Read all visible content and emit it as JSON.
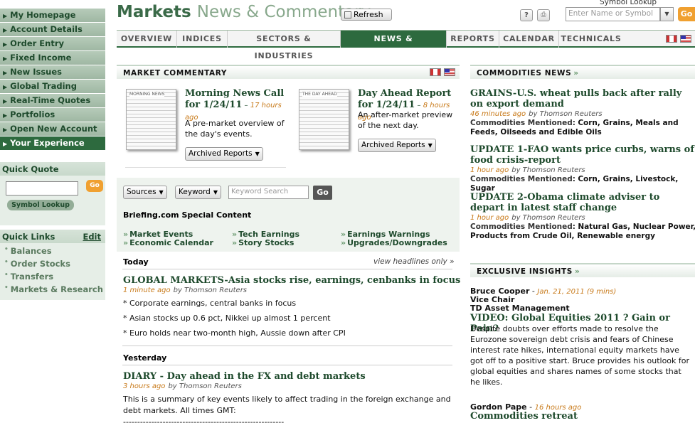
{
  "sidebar": {
    "nav": [
      {
        "label": "My Homepage"
      },
      {
        "label": "Account Details"
      },
      {
        "label": "Order Entry"
      },
      {
        "label": "Fixed Income"
      },
      {
        "label": "New Issues"
      },
      {
        "label": "Global Trading"
      },
      {
        "label": "Real-Time Quotes"
      },
      {
        "label": "Portfolios"
      },
      {
        "label": "Open New Account"
      },
      {
        "label": "Your Experience"
      }
    ],
    "quick_quote": {
      "title": "Quick Quote",
      "go": "Go",
      "symbol_lookup": "Symbol Lookup",
      "value": ""
    },
    "quick_links": {
      "title": "Quick Links",
      "edit": "Edit",
      "items": [
        "Balances",
        "Order Stocks",
        "Transfers",
        "Markets & Research"
      ]
    }
  },
  "header": {
    "title_main": "Markets",
    "title_sub": "News & Commentary",
    "refresh": "Refresh",
    "help": "?",
    "print": "⎙",
    "symbol_lookup_label": "Symbol Lookup",
    "search_placeholder": "Enter Name or Symbol",
    "go": "Go"
  },
  "tabs": [
    "OVERVIEW",
    "INDICES",
    "SECTORS & INDUSTRIES",
    "NEWS & COMMENTARY",
    "REPORTS",
    "CALENDAR",
    "TECHNICALS"
  ],
  "market_commentary": {
    "title": "MARKET COMMENTARY",
    "reports": [
      {
        "thumb": "MORNING NEWS",
        "title": "Morning News Call for 1/24/11",
        "sep": " – ",
        "time": "17 hours ago",
        "desc": "A pre-market overview of the day's events.",
        "archived": "Archived Reports"
      },
      {
        "thumb": "THE DAY AHEAD",
        "title": "Day Ahead Report for 1/24/11",
        "sep": " – ",
        "time": "8 hours ago",
        "desc": "An after-market preview of the next day.",
        "archived": "Archived Reports"
      }
    ]
  },
  "filters": {
    "sources": "Sources",
    "keyword": "Keyword",
    "keyword_placeholder": "Keyword Search",
    "go": "Go",
    "briefing_title": "Briefing.com Special Content",
    "links": [
      "Market Events",
      "Tech Earnings",
      "Earnings Warnings",
      "Economic Calendar",
      "Story Stocks",
      "Upgrades/Downgrades"
    ]
  },
  "news": {
    "today_label": "Today",
    "view_headlines": "view headlines only »",
    "today": {
      "headline": "GLOBAL MARKETS-Asia stocks rise, earnings, cenbanks in focus",
      "time": "1 minute ago",
      "source": "by Thomson Reuters",
      "bullets": [
        "* Corporate earnings, central banks in focus",
        "* Asian stocks up 0.6 pct, Nikkei up almost 1 percent",
        "* Euro holds near two-month high, Aussie down after CPI"
      ]
    },
    "yesterday_label": "Yesterday",
    "yesterday": {
      "headline": "DIARY - Day ahead in the FX and debt markets",
      "time": "3 hours ago",
      "source": "by Thomson Reuters",
      "body": "This is a summary of key events likely to affect trading in the foreign exchange and debt markets. All times GMT:",
      "rule": "---------------------------------------------------------"
    }
  },
  "commodities": {
    "title": "COMMODITIES NEWS",
    "mentioned_label": "Commodities Mentioned:",
    "items": [
      {
        "headline": "GRAINS-U.S. wheat pulls back after rally on export demand",
        "time": "46 minutes ago",
        "source": "by Thomson Reuters",
        "mentioned": "Corn, Grains, Meals and Feeds, Oilseeds and Edible Oils"
      },
      {
        "headline": "UPDATE 1-FAO wants price curbs, warns of food crisis-report",
        "time": "1 hour ago",
        "source": "by Thomson Reuters",
        "mentioned": "Corn, Grains, Livestock, Sugar"
      },
      {
        "headline": "UPDATE 2-Obama climate adviser to depart in latest staff change",
        "time": "1 hour ago",
        "source": "by Thomson Reuters",
        "mentioned": "Natural Gas, Nuclear Power, Products from Crude Oil, Renewable energy"
      }
    ]
  },
  "insights": {
    "title": "EXCLUSIVE INSIGHTS",
    "first": {
      "author": "Bruce Cooper",
      "sep": " - ",
      "date": "Jan. 21, 2011 (9 mins)",
      "role": "Vice Chair",
      "org": "TD Asset Management",
      "headline": "VIDEO: Global Equities 2011 ? Gain or Pain?",
      "body": "Despite doubts over efforts made to resolve the Eurozone sovereign debt crisis and fears of Chinese interest rate hikes, international equity markets have got off to a positive start. Bruce provides his outlook for global equities and shares names of some stocks that he likes."
    },
    "second": {
      "author": "Gordon Pape",
      "sep": " - ",
      "time": "16 hours ago",
      "headline": "Commodities retreat"
    }
  },
  "colors": {
    "brand_green": "#2d6a3e",
    "accent_orange": "#f0a030",
    "timestamp": "#c87a1a"
  },
  "icons": {
    "refresh": "refresh-icon",
    "help": "help-icon",
    "print": "print-icon",
    "nav_arrow": "triangle-right-icon",
    "flags": [
      "canada-flag-icon",
      "us-flag-icon"
    ]
  }
}
